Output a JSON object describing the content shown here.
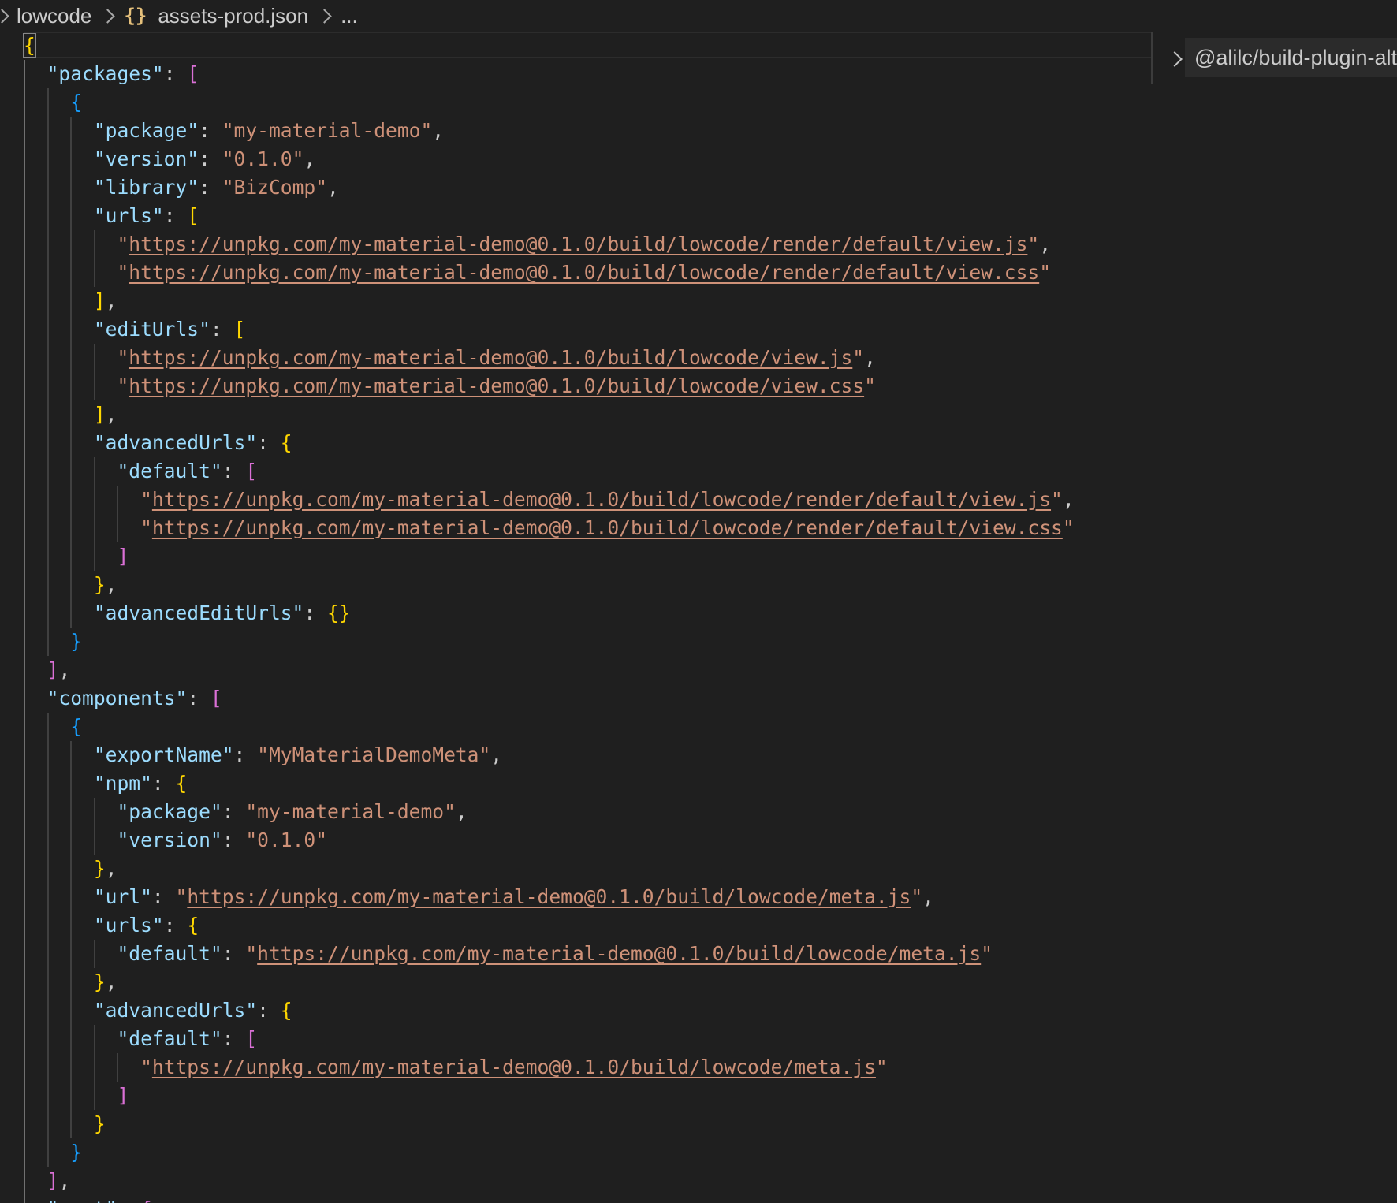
{
  "breadcrumb": {
    "folder": "lowcode",
    "file_icon": "{}",
    "file": "assets-prod.json",
    "more": "..."
  },
  "sticky_scroll": {
    "label": "@alilc/build-plugin-alt"
  },
  "colors": {
    "background": "#1f1f1f",
    "key": "#9cdcfe",
    "string": "#ce9178",
    "bracket_level1": "#ffd700",
    "bracket_level2": "#da70d6",
    "bracket_level3": "#179fff"
  },
  "code": {
    "lines": [
      [
        [
          "b1",
          "{"
        ]
      ],
      [
        [
          "p",
          "  "
        ],
        [
          "k",
          "\"packages\""
        ],
        [
          "p",
          ": "
        ],
        [
          "b2",
          "["
        ]
      ],
      [
        [
          "p",
          "    "
        ],
        [
          "b3",
          "{"
        ]
      ],
      [
        [
          "p",
          "      "
        ],
        [
          "k",
          "\"package\""
        ],
        [
          "p",
          ": "
        ],
        [
          "s",
          "\"my-material-demo\""
        ],
        [
          "p",
          ","
        ]
      ],
      [
        [
          "p",
          "      "
        ],
        [
          "k",
          "\"version\""
        ],
        [
          "p",
          ": "
        ],
        [
          "s",
          "\"0.1.0\""
        ],
        [
          "p",
          ","
        ]
      ],
      [
        [
          "p",
          "      "
        ],
        [
          "k",
          "\"library\""
        ],
        [
          "p",
          ": "
        ],
        [
          "s",
          "\"BizComp\""
        ],
        [
          "p",
          ","
        ]
      ],
      [
        [
          "p",
          "      "
        ],
        [
          "k",
          "\"urls\""
        ],
        [
          "p",
          ": "
        ],
        [
          "b1",
          "["
        ]
      ],
      [
        [
          "p",
          "        "
        ],
        [
          "s",
          "\""
        ],
        [
          "u",
          "https://unpkg.com/my-material-demo@0.1.0/build/lowcode/render/default/view.js"
        ],
        [
          "s",
          "\""
        ],
        [
          "p",
          ","
        ]
      ],
      [
        [
          "p",
          "        "
        ],
        [
          "s",
          "\""
        ],
        [
          "u",
          "https://unpkg.com/my-material-demo@0.1.0/build/lowcode/render/default/view.css"
        ],
        [
          "s",
          "\""
        ]
      ],
      [
        [
          "p",
          "      "
        ],
        [
          "b1",
          "]"
        ],
        [
          "p",
          ","
        ]
      ],
      [
        [
          "p",
          "      "
        ],
        [
          "k",
          "\"editUrls\""
        ],
        [
          "p",
          ": "
        ],
        [
          "b1",
          "["
        ]
      ],
      [
        [
          "p",
          "        "
        ],
        [
          "s",
          "\""
        ],
        [
          "u",
          "https://unpkg.com/my-material-demo@0.1.0/build/lowcode/view.js"
        ],
        [
          "s",
          "\""
        ],
        [
          "p",
          ","
        ]
      ],
      [
        [
          "p",
          "        "
        ],
        [
          "s",
          "\""
        ],
        [
          "u",
          "https://unpkg.com/my-material-demo@0.1.0/build/lowcode/view.css"
        ],
        [
          "s",
          "\""
        ]
      ],
      [
        [
          "p",
          "      "
        ],
        [
          "b1",
          "]"
        ],
        [
          "p",
          ","
        ]
      ],
      [
        [
          "p",
          "      "
        ],
        [
          "k",
          "\"advancedUrls\""
        ],
        [
          "p",
          ": "
        ],
        [
          "b1",
          "{"
        ]
      ],
      [
        [
          "p",
          "        "
        ],
        [
          "k",
          "\"default\""
        ],
        [
          "p",
          ": "
        ],
        [
          "b2",
          "["
        ]
      ],
      [
        [
          "p",
          "          "
        ],
        [
          "s",
          "\""
        ],
        [
          "u",
          "https://unpkg.com/my-material-demo@0.1.0/build/lowcode/render/default/view.js"
        ],
        [
          "s",
          "\""
        ],
        [
          "p",
          ","
        ]
      ],
      [
        [
          "p",
          "          "
        ],
        [
          "s",
          "\""
        ],
        [
          "u",
          "https://unpkg.com/my-material-demo@0.1.0/build/lowcode/render/default/view.css"
        ],
        [
          "s",
          "\""
        ]
      ],
      [
        [
          "p",
          "        "
        ],
        [
          "b2",
          "]"
        ]
      ],
      [
        [
          "p",
          "      "
        ],
        [
          "b1",
          "}"
        ],
        [
          "p",
          ","
        ]
      ],
      [
        [
          "p",
          "      "
        ],
        [
          "k",
          "\"advancedEditUrls\""
        ],
        [
          "p",
          ": "
        ],
        [
          "b1",
          "{}"
        ]
      ],
      [
        [
          "p",
          "    "
        ],
        [
          "b3",
          "}"
        ]
      ],
      [
        [
          "p",
          "  "
        ],
        [
          "b2",
          "]"
        ],
        [
          "p",
          ","
        ]
      ],
      [
        [
          "p",
          "  "
        ],
        [
          "k",
          "\"components\""
        ],
        [
          "p",
          ": "
        ],
        [
          "b2",
          "["
        ]
      ],
      [
        [
          "p",
          "    "
        ],
        [
          "b3",
          "{"
        ]
      ],
      [
        [
          "p",
          "      "
        ],
        [
          "k",
          "\"exportName\""
        ],
        [
          "p",
          ": "
        ],
        [
          "s",
          "\"MyMaterialDemoMeta\""
        ],
        [
          "p",
          ","
        ]
      ],
      [
        [
          "p",
          "      "
        ],
        [
          "k",
          "\"npm\""
        ],
        [
          "p",
          ": "
        ],
        [
          "b1",
          "{"
        ]
      ],
      [
        [
          "p",
          "        "
        ],
        [
          "k",
          "\"package\""
        ],
        [
          "p",
          ": "
        ],
        [
          "s",
          "\"my-material-demo\""
        ],
        [
          "p",
          ","
        ]
      ],
      [
        [
          "p",
          "        "
        ],
        [
          "k",
          "\"version\""
        ],
        [
          "p",
          ": "
        ],
        [
          "s",
          "\"0.1.0\""
        ]
      ],
      [
        [
          "p",
          "      "
        ],
        [
          "b1",
          "}"
        ],
        [
          "p",
          ","
        ]
      ],
      [
        [
          "p",
          "      "
        ],
        [
          "k",
          "\"url\""
        ],
        [
          "p",
          ": "
        ],
        [
          "s",
          "\""
        ],
        [
          "u",
          "https://unpkg.com/my-material-demo@0.1.0/build/lowcode/meta.js"
        ],
        [
          "s",
          "\""
        ],
        [
          "p",
          ","
        ]
      ],
      [
        [
          "p",
          "      "
        ],
        [
          "k",
          "\"urls\""
        ],
        [
          "p",
          ": "
        ],
        [
          "b1",
          "{"
        ]
      ],
      [
        [
          "p",
          "        "
        ],
        [
          "k",
          "\"default\""
        ],
        [
          "p",
          ": "
        ],
        [
          "s",
          "\""
        ],
        [
          "u",
          "https://unpkg.com/my-material-demo@0.1.0/build/lowcode/meta.js"
        ],
        [
          "s",
          "\""
        ]
      ],
      [
        [
          "p",
          "      "
        ],
        [
          "b1",
          "}"
        ],
        [
          "p",
          ","
        ]
      ],
      [
        [
          "p",
          "      "
        ],
        [
          "k",
          "\"advancedUrls\""
        ],
        [
          "p",
          ": "
        ],
        [
          "b1",
          "{"
        ]
      ],
      [
        [
          "p",
          "        "
        ],
        [
          "k",
          "\"default\""
        ],
        [
          "p",
          ": "
        ],
        [
          "b2",
          "["
        ]
      ],
      [
        [
          "p",
          "          "
        ],
        [
          "s",
          "\""
        ],
        [
          "u",
          "https://unpkg.com/my-material-demo@0.1.0/build/lowcode/meta.js"
        ],
        [
          "s",
          "\""
        ]
      ],
      [
        [
          "p",
          "        "
        ],
        [
          "b2",
          "]"
        ]
      ],
      [
        [
          "p",
          "      "
        ],
        [
          "b1",
          "}"
        ]
      ],
      [
        [
          "p",
          "    "
        ],
        [
          "b3",
          "}"
        ]
      ],
      [
        [
          "p",
          "  "
        ],
        [
          "b2",
          "]"
        ],
        [
          "p",
          ","
        ]
      ],
      [
        [
          "p",
          "  "
        ],
        [
          "k",
          "\"sort\""
        ],
        [
          "p",
          ": "
        ],
        [
          "b2",
          "{"
        ]
      ]
    ]
  }
}
